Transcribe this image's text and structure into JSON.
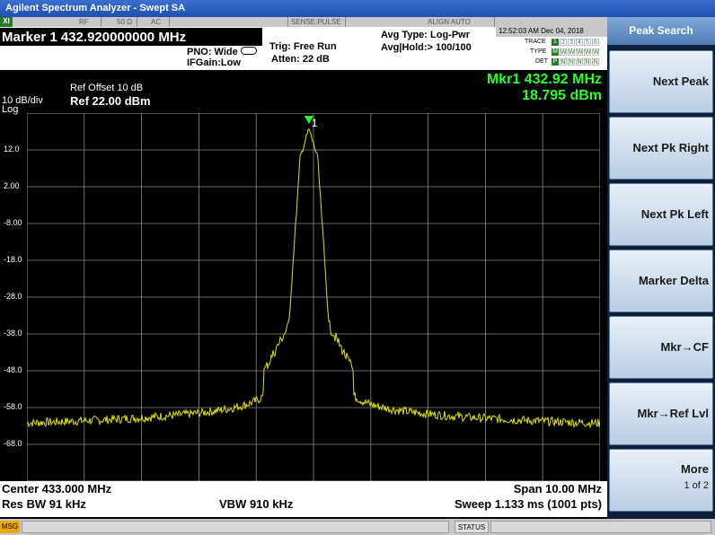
{
  "window": {
    "title": "Agilent Spectrum Analyzer - Swept SA"
  },
  "status_strip": {
    "logo": "XI",
    "rf": "RF",
    "impedance": "50 Ω",
    "coupling": "AC",
    "sense": "SENSE:PULSE",
    "align": "ALIGN AUTO"
  },
  "header": {
    "marker_readout": "Marker 1 432.920000000 MHz",
    "pno": "PNO: Wide",
    "ifgain": "IFGain:Low",
    "trig": "Trig: Free Run",
    "atten": "Atten: 22 dB",
    "avg_type": "Avg Type: Log-Pwr",
    "avg_hold": "Avg|Hold:> 100/100",
    "datetime": "12:52:03 AM Dec 04, 2018",
    "trace_label": "TRACE",
    "type_label": "TYPE",
    "det_label": "DET",
    "trace_cells": [
      "1",
      "2",
      "3",
      "4",
      "5",
      "6"
    ],
    "type_cells": [
      "M",
      "W",
      "W",
      "W",
      "W",
      "W"
    ],
    "det_cells": [
      "P",
      "N",
      "N",
      "N",
      "N",
      "N"
    ]
  },
  "graph": {
    "ref_offset": "Ref Offset 10 dB",
    "scale": "10 dB/div",
    "ref_level": "Ref 22.00 dBm",
    "log": "Log",
    "mkr_freq": "Mkr1 432.92 MHz",
    "mkr_level": "18.795 dBm",
    "marker_number": "1",
    "y_ticks": [
      "12.0",
      "2.00",
      "-8.00",
      "-18.0",
      "-28.0",
      "-38.0",
      "-48.0",
      "-58.0",
      "-68.0"
    ]
  },
  "footer": {
    "center": "Center 433.000 MHz",
    "span": "Span 10.00 MHz",
    "res_bw": "Res BW 91 kHz",
    "vbw": "VBW 910 kHz",
    "sweep": "Sweep  1.133 ms (1001 pts)"
  },
  "bottom": {
    "msg": "MSG",
    "status": "STATUS"
  },
  "softkeys": {
    "title": "Peak Search",
    "items": [
      {
        "label": "Next Peak"
      },
      {
        "label": "Next Pk Right"
      },
      {
        "label": "Next Pk Left"
      },
      {
        "label": "Marker Delta"
      },
      {
        "label": "Mkr→CF"
      },
      {
        "label": "Mkr→Ref Lvl"
      },
      {
        "label": "More",
        "sub": "1 of 2"
      }
    ]
  },
  "colors": {
    "trace": "#e0e000",
    "marker": "#29ff29",
    "grid": "#8a8a8a"
  }
}
